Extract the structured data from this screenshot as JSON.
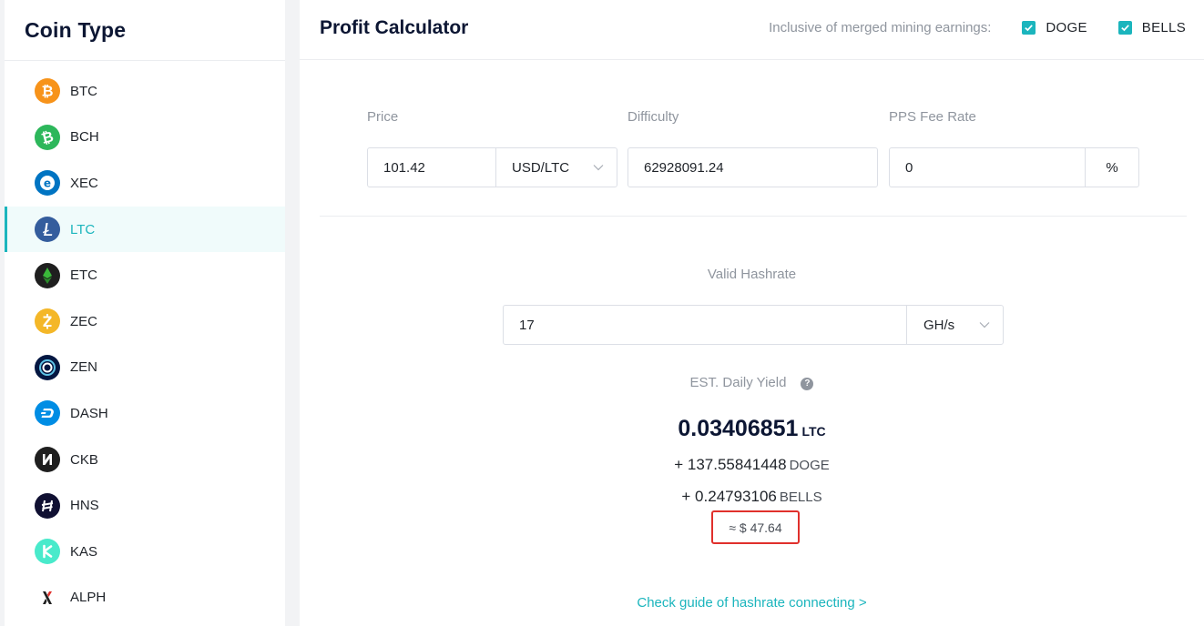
{
  "sidebar": {
    "title": "Coin Type",
    "active": "LTC",
    "items": [
      {
        "label": "BTC",
        "icon": "btc-icon",
        "color": "#f7931a"
      },
      {
        "label": "BCH",
        "icon": "bch-icon",
        "color": "#2db75b"
      },
      {
        "label": "XEC",
        "icon": "xec-icon",
        "color": "#0074c2"
      },
      {
        "label": "LTC",
        "icon": "ltc-icon",
        "color": "#345d9d"
      },
      {
        "label": "ETC",
        "icon": "etc-icon",
        "color": "#328432"
      },
      {
        "label": "ZEC",
        "icon": "zec-icon",
        "color": "#f4b728"
      },
      {
        "label": "ZEN",
        "icon": "zen-icon",
        "color": "#041742"
      },
      {
        "label": "DASH",
        "icon": "dash-icon",
        "color": "#008de4"
      },
      {
        "label": "CKB",
        "icon": "ckb-icon",
        "color": "#1f1f1f"
      },
      {
        "label": "HNS",
        "icon": "hns-icon",
        "color": "#101032"
      },
      {
        "label": "KAS",
        "icon": "kas-icon",
        "color": "#49eacb"
      },
      {
        "label": "ALPH",
        "icon": "alph-icon",
        "color": "#ffffff"
      }
    ]
  },
  "header": {
    "title": "Profit Calculator",
    "merged_label": "Inclusive of merged mining earnings:",
    "merged_options": [
      {
        "label": "DOGE",
        "checked": true
      },
      {
        "label": "BELLS",
        "checked": true
      }
    ]
  },
  "form": {
    "price_label": "Price",
    "price_value": "101.42",
    "price_unit": "USD/LTC",
    "difficulty_label": "Difficulty",
    "difficulty_value": "62928091.24",
    "fee_label": "PPS Fee Rate",
    "fee_value": "0",
    "fee_unit": "%",
    "hashrate_label": "Valid Hashrate",
    "hashrate_value": "17",
    "hashrate_unit": "GH/s"
  },
  "yield": {
    "label": "EST. Daily Yield",
    "help_glyph": "?",
    "main_value": "0.03406851",
    "main_unit": "LTC",
    "doge_value": "+ 137.55841448",
    "doge_unit": "DOGE",
    "bells_value": "+ 0.24793106",
    "bells_unit": "BELLS",
    "usd": "≈ $ 47.64"
  },
  "guide_link": "Check guide of hashrate connecting >",
  "colors": {
    "accent": "#1bb5bd",
    "highlight": "#e0302c"
  }
}
